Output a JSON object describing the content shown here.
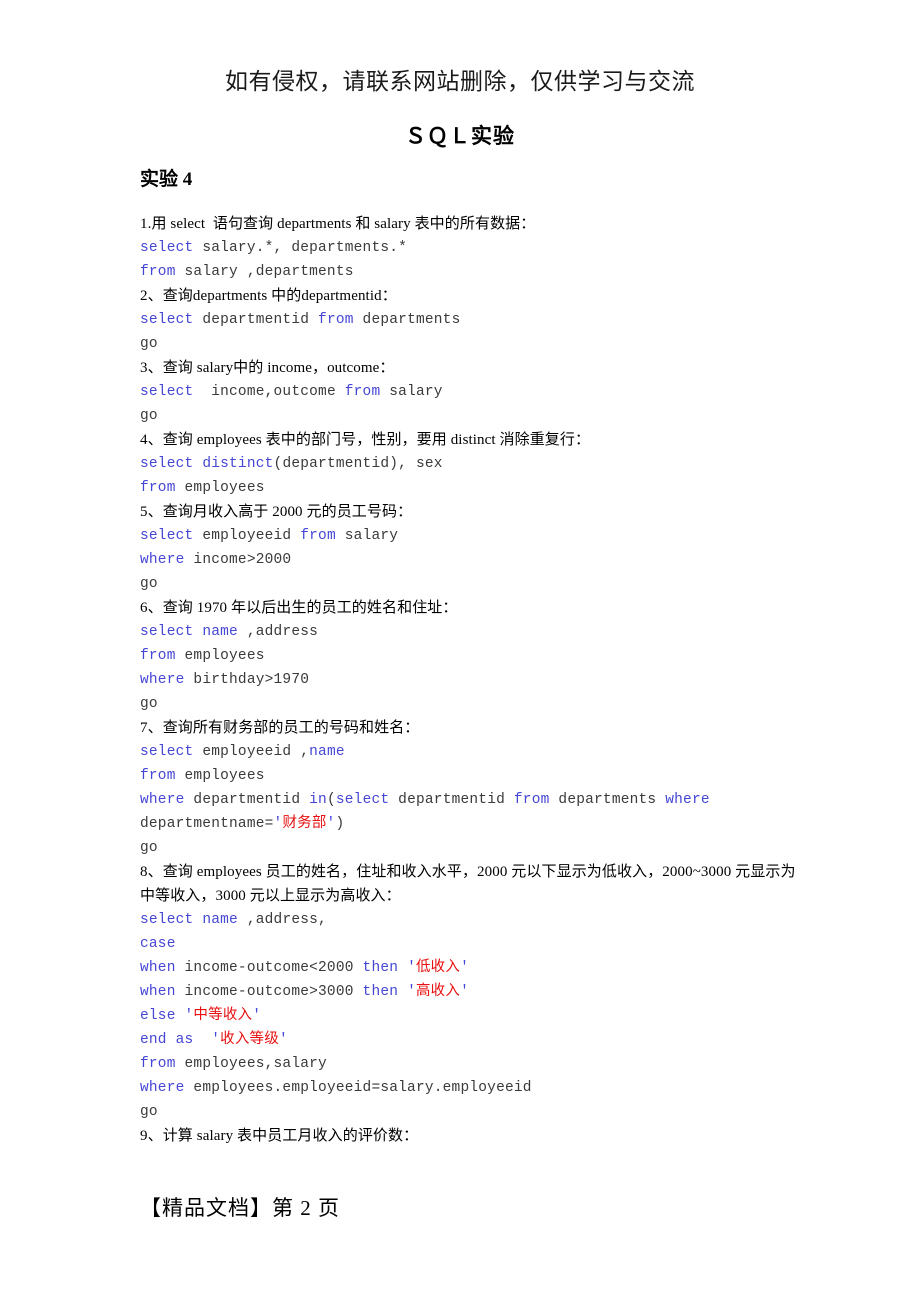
{
  "document": {
    "watermark": "如有侵权，请联系网站删除，仅供学习与交流",
    "title": "ＳＱＬ实验",
    "section_heading": "实验 4",
    "footer": "【精品文档】第 2 页"
  },
  "colors": {
    "keyword": "#4646d6",
    "string": "#e81010",
    "code_text": "#3a3a3a",
    "body_text": "#000000",
    "page_background": "#ffffff"
  },
  "body_lines": [
    {
      "kind": "prose",
      "text": "1.用 select  语句查询 departments 和 salary 表中的所有数据："
    },
    {
      "kind": "code",
      "tokens": [
        {
          "t": "select",
          "c": "kw"
        },
        {
          "t": " salary.*, departments.*",
          "c": ""
        }
      ]
    },
    {
      "kind": "code",
      "tokens": [
        {
          "t": "from",
          "c": "kw"
        },
        {
          "t": " salary ,departments",
          "c": ""
        }
      ]
    },
    {
      "kind": "prose",
      "text": "2、查询departments 中的departmentid："
    },
    {
      "kind": "code",
      "tokens": [
        {
          "t": "select",
          "c": "kw"
        },
        {
          "t": " departmentid ",
          "c": ""
        },
        {
          "t": "from",
          "c": "kw"
        },
        {
          "t": " departments",
          "c": ""
        }
      ]
    },
    {
      "kind": "code",
      "tokens": [
        {
          "t": "go",
          "c": ""
        }
      ]
    },
    {
      "kind": "prose",
      "text": "3、查询 salary中的 income，outcome："
    },
    {
      "kind": "code",
      "tokens": [
        {
          "t": "select",
          "c": "kw"
        },
        {
          "t": "  income,outcome ",
          "c": ""
        },
        {
          "t": "from",
          "c": "kw"
        },
        {
          "t": " salary",
          "c": ""
        }
      ]
    },
    {
      "kind": "code",
      "tokens": [
        {
          "t": "go",
          "c": ""
        }
      ]
    },
    {
      "kind": "prose",
      "text": "4、查询 employees 表中的部门号，性别，要用 distinct 消除重复行："
    },
    {
      "kind": "code",
      "tokens": [
        {
          "t": "select",
          "c": "kw"
        },
        {
          "t": " ",
          "c": ""
        },
        {
          "t": "distinct",
          "c": "kw"
        },
        {
          "t": "(departmentid), sex",
          "c": ""
        }
      ]
    },
    {
      "kind": "code",
      "tokens": [
        {
          "t": "from",
          "c": "kw"
        },
        {
          "t": " employees",
          "c": ""
        }
      ]
    },
    {
      "kind": "prose",
      "text": "5、查询月收入高于 2000 元的员工号码："
    },
    {
      "kind": "code",
      "tokens": [
        {
          "t": "select",
          "c": "kw"
        },
        {
          "t": " employeeid ",
          "c": ""
        },
        {
          "t": "from",
          "c": "kw"
        },
        {
          "t": " salary",
          "c": ""
        }
      ]
    },
    {
      "kind": "code",
      "tokens": [
        {
          "t": "where",
          "c": "kw"
        },
        {
          "t": " income>2000",
          "c": ""
        }
      ]
    },
    {
      "kind": "code",
      "tokens": [
        {
          "t": "go",
          "c": ""
        }
      ]
    },
    {
      "kind": "prose",
      "text": "6、查询 1970 年以后出生的员工的姓名和住址："
    },
    {
      "kind": "code",
      "tokens": [
        {
          "t": "select",
          "c": "kw"
        },
        {
          "t": " ",
          "c": ""
        },
        {
          "t": "name",
          "c": "kw"
        },
        {
          "t": " ,address",
          "c": ""
        }
      ]
    },
    {
      "kind": "code",
      "tokens": [
        {
          "t": "from",
          "c": "kw"
        },
        {
          "t": " employees",
          "c": ""
        }
      ]
    },
    {
      "kind": "code",
      "tokens": [
        {
          "t": "where",
          "c": "kw"
        },
        {
          "t": " birthday>1970",
          "c": ""
        }
      ]
    },
    {
      "kind": "code",
      "tokens": [
        {
          "t": "go",
          "c": ""
        }
      ]
    },
    {
      "kind": "prose",
      "text": "7、查询所有财务部的员工的号码和姓名："
    },
    {
      "kind": "code",
      "tokens": [
        {
          "t": "select",
          "c": "kw"
        },
        {
          "t": " employeeid ,",
          "c": ""
        },
        {
          "t": "name",
          "c": "kw"
        }
      ]
    },
    {
      "kind": "code",
      "tokens": [
        {
          "t": "from",
          "c": "kw"
        },
        {
          "t": " employees",
          "c": ""
        }
      ]
    },
    {
      "kind": "code_wrap",
      "tokens": [
        {
          "t": "where",
          "c": "kw"
        },
        {
          "t": " departmentid ",
          "c": ""
        },
        {
          "t": "in",
          "c": "kw"
        },
        {
          "t": "(",
          "c": ""
        },
        {
          "t": "select",
          "c": "kw"
        },
        {
          "t": " departmentid ",
          "c": ""
        },
        {
          "t": "from",
          "c": "kw"
        },
        {
          "t": " departments ",
          "c": ""
        },
        {
          "t": "where",
          "c": "kw"
        },
        {
          "t": " departmentname=",
          "c": ""
        },
        {
          "t": "'",
          "c": "q"
        },
        {
          "t": "财务部",
          "c": "str"
        },
        {
          "t": "'",
          "c": "q"
        },
        {
          "t": ")",
          "c": ""
        }
      ]
    },
    {
      "kind": "code",
      "tokens": [
        {
          "t": "go",
          "c": ""
        }
      ]
    },
    {
      "kind": "prose_wrap",
      "text": "8、查询 employees 员工的姓名，住址和收入水平，2000 元以下显示为低收入，2000~3000 元显示为中等收入，3000 元以上显示为高收入："
    },
    {
      "kind": "code",
      "tokens": [
        {
          "t": "select",
          "c": "kw"
        },
        {
          "t": " ",
          "c": ""
        },
        {
          "t": "name",
          "c": "kw"
        },
        {
          "t": " ,address,",
          "c": ""
        }
      ]
    },
    {
      "kind": "code",
      "tokens": [
        {
          "t": "case",
          "c": "kw"
        }
      ]
    },
    {
      "kind": "code",
      "tokens": [
        {
          "t": "when",
          "c": "kw"
        },
        {
          "t": " income-outcome<2000 ",
          "c": ""
        },
        {
          "t": "then",
          "c": "kw"
        },
        {
          "t": " ",
          "c": ""
        },
        {
          "t": "'",
          "c": "q"
        },
        {
          "t": "低收入",
          "c": "str"
        },
        {
          "t": "'",
          "c": "q"
        }
      ]
    },
    {
      "kind": "code",
      "tokens": [
        {
          "t": "when",
          "c": "kw"
        },
        {
          "t": " income-outcome>3000 ",
          "c": ""
        },
        {
          "t": "then",
          "c": "kw"
        },
        {
          "t": " ",
          "c": ""
        },
        {
          "t": "'",
          "c": "q"
        },
        {
          "t": "高收入",
          "c": "str"
        },
        {
          "t": "'",
          "c": "q"
        }
      ]
    },
    {
      "kind": "code",
      "tokens": [
        {
          "t": "else",
          "c": "kw"
        },
        {
          "t": " ",
          "c": ""
        },
        {
          "t": "'",
          "c": "q"
        },
        {
          "t": "中等收入",
          "c": "str"
        },
        {
          "t": "'",
          "c": "q"
        }
      ]
    },
    {
      "kind": "code",
      "tokens": [
        {
          "t": "end",
          "c": "kw"
        },
        {
          "t": " ",
          "c": ""
        },
        {
          "t": "as",
          "c": "kw"
        },
        {
          "t": "  ",
          "c": ""
        },
        {
          "t": "'",
          "c": "q"
        },
        {
          "t": "收入等级",
          "c": "str"
        },
        {
          "t": "'",
          "c": "q"
        }
      ]
    },
    {
      "kind": "code",
      "tokens": [
        {
          "t": "from",
          "c": "kw"
        },
        {
          "t": " employees,salary",
          "c": ""
        }
      ]
    },
    {
      "kind": "code",
      "tokens": [
        {
          "t": "where",
          "c": "kw"
        },
        {
          "t": " employees.employeeid=salary.employeeid",
          "c": ""
        }
      ]
    },
    {
      "kind": "code",
      "tokens": [
        {
          "t": "go",
          "c": ""
        }
      ]
    },
    {
      "kind": "prose",
      "text": "9、计算 salary 表中员工月收入的评价数："
    }
  ]
}
